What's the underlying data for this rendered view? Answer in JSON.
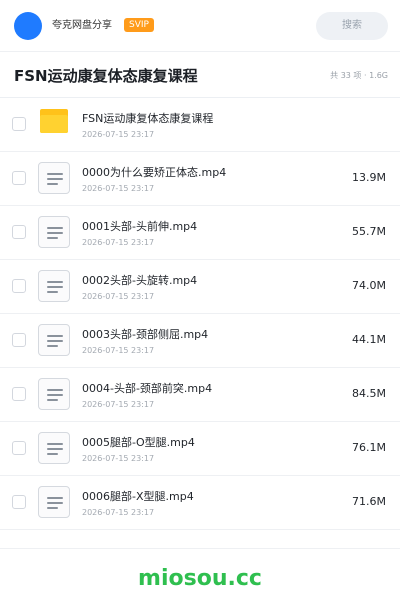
{
  "topbar": {
    "username": "夸克网盘分享",
    "badge": "SVIP",
    "search_placeholder": "搜索",
    "avatar_color": "#1f7bff"
  },
  "folder": {
    "title": "FSN运动康复体态康复课程",
    "meta": "共 33 项 · 1.6G"
  },
  "items": [
    {
      "type": "folder",
      "icon": "folder-icon",
      "name": "FSN运动康复体态康复课程",
      "date": "2026-07-15 23:17",
      "size": ""
    },
    {
      "type": "file",
      "icon": "document-icon",
      "name": "0000为什么要矫正体态.mp4",
      "date": "2026-07-15 23:17",
      "size": "13.9M"
    },
    {
      "type": "file",
      "icon": "document-icon",
      "name": "0001头部-头前伸.mp4",
      "date": "2026-07-15 23:17",
      "size": "55.7M"
    },
    {
      "type": "file",
      "icon": "document-icon",
      "name": "0002头部-头旋转.mp4",
      "date": "2026-07-15 23:17",
      "size": "74.0M"
    },
    {
      "type": "file",
      "icon": "document-icon",
      "name": "0003头部-颈部侧屈.mp4",
      "date": "2026-07-15 23:17",
      "size": "44.1M"
    },
    {
      "type": "file",
      "icon": "document-icon",
      "name": "0004-头部-颈部前突.mp4",
      "date": "2026-07-15 23:17",
      "size": "84.5M"
    },
    {
      "type": "file",
      "icon": "document-icon",
      "name": "0005腿部-O型腿.mp4",
      "date": "2026-07-15 23:17",
      "size": "76.1M"
    },
    {
      "type": "file",
      "icon": "document-icon",
      "name": "0006腿部-X型腿.mp4",
      "date": "2026-07-15 23:17",
      "size": "71.6M"
    }
  ],
  "watermark": "miosou.cc",
  "colors": {
    "accent": "#1f7bff",
    "svip": "#ff9b1a",
    "folder": "#ffc21a",
    "watermark": "#2fbf4f"
  }
}
